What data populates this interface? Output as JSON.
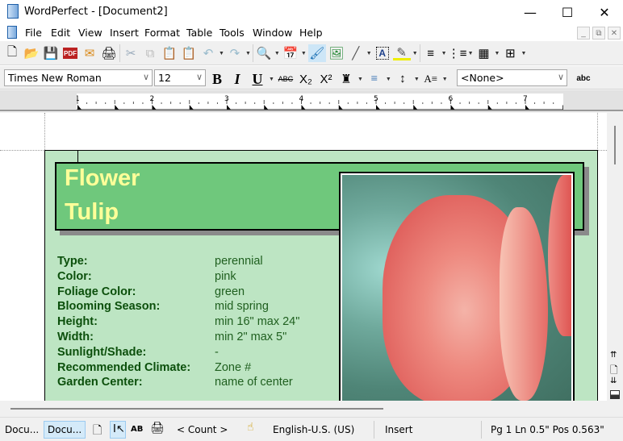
{
  "window": {
    "title": "WordPerfect - [Document2]",
    "controls": [
      "minimize",
      "maximize",
      "close"
    ]
  },
  "menu": [
    "File",
    "Edit",
    "View",
    "Insert",
    "Format",
    "Table",
    "Tools",
    "Window",
    "Help"
  ],
  "toolbar1": {
    "icons": [
      "new-document",
      "open",
      "save",
      "publish-pdf",
      "email",
      "print",
      "cut",
      "copy",
      "paste",
      "paste-special",
      "undo",
      "redo",
      "zoom",
      "calendar",
      "format-painter",
      "insert-image",
      "line",
      "text-box",
      "highlight",
      "numbering",
      "bullets",
      "columns",
      "table"
    ]
  },
  "toolbar2": {
    "font": "Times New Roman",
    "size": "12",
    "style": "<None>",
    "buttons": [
      "B",
      "I",
      "U",
      "ABC",
      "X₂",
      "X²"
    ]
  },
  "ruler": {
    "marks": [
      "1",
      "2",
      "3",
      "4",
      "5",
      "6",
      "7"
    ]
  },
  "document": {
    "title_line1": "Flower",
    "title_line2": "Tulip",
    "fields": [
      {
        "label": "Type:",
        "value": "perennial"
      },
      {
        "label": "Color:",
        "value": "pink"
      },
      {
        "label": "Foliage Color:",
        "value": "green"
      },
      {
        "label": "Blooming Season:",
        "value": "mid spring"
      },
      {
        "label": "Height:",
        "value": "min 16\" max 24\""
      },
      {
        "label": "Width:",
        "value": "min 2\" max 5\""
      },
      {
        "label": "Sunlight/Shade:",
        "value": "-"
      },
      {
        "label": "Recommended Climate:",
        "value": "Zone #"
      },
      {
        "label": "Garden Center:",
        "value": "name of center"
      }
    ]
  },
  "status": {
    "doc1": "Docu...",
    "doc2": "Docu...",
    "count": "< Count >",
    "language": "English-U.S. (US)",
    "mode": "Insert",
    "position": "Pg 1 Ln 0.5\" Pos 0.563\""
  },
  "colors": {
    "card": "#bde5c3",
    "header": "#6fc87c",
    "title_text": "#ffff99",
    "label_text": "#0b4f0b"
  }
}
